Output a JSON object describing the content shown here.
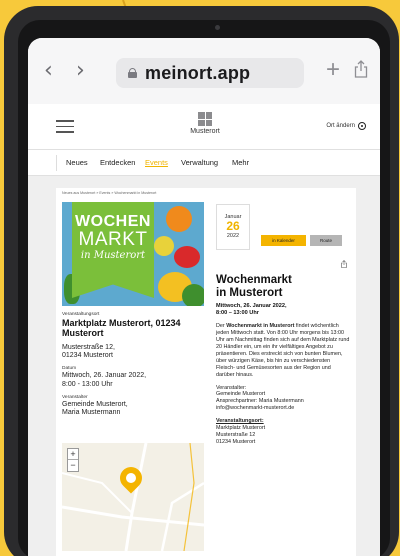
{
  "browser": {
    "url": "meinort.app",
    "back_icon": "chevron-left-icon",
    "forward_icon": "chevron-right-icon"
  },
  "header": {
    "logo_text": "Musterort",
    "location_label": "Ort ändern"
  },
  "menu": {
    "items": [
      "Neues",
      "Entdecken",
      "Events",
      "Verwaltung",
      "Mehr"
    ],
    "active": "Events",
    "active_color": "#f0b400"
  },
  "breadcrumb": "Neues aus Musterort » Events » Wochenmarkt in Musterort",
  "hero": {
    "line1": "WOCHEN",
    "line2": "MARKT",
    "line3": "in Musterort",
    "banner_color": "#7bbf3a"
  },
  "venue": {
    "label": "Veranstaltungsort",
    "name": "Marktplatz Musterort, 01234 Musterort",
    "street": "Musterstraße 12,",
    "city": "01234 Musterort"
  },
  "date_info": {
    "label": "Datum",
    "line1": "Mittwoch, 26. Januar 2022,",
    "line2": "8:00 - 13:00 Uhr"
  },
  "organizer": {
    "label": "Veranstalter",
    "line1": "Gemeinde Musterort,",
    "line2": "Maria Mustermann"
  },
  "map": {
    "zoom_in": "+",
    "zoom_out": "−"
  },
  "date_box": {
    "month": "Januar",
    "day": "26",
    "year": "2022"
  },
  "buttons": {
    "calendar": "in Kalender",
    "route": "Route"
  },
  "event": {
    "title_line1": "Wochenmarkt",
    "title_line2": "in Musterort",
    "date_line1": "Mittwoch, 26. Januar 2022,",
    "date_line2": "8:00 – 13:00 Uhr",
    "desc_bold": "Wochenmarkt in Musterort",
    "desc_prefix": "Der ",
    "desc_rest": " findet wöchentlich jeden Mittwoch statt. Von 8:00 Uhr morgens bis 13:00 Uhr am Nachmittag finden sich auf dem Marktplatz rund 20 Händler ein, um ein ihr vielfältiges Angebot zu präsentieren. Dies erstreckt sich von bunten Blumen, über würzigen Käse, bis hin zu verschiedensten Fleisch- und Gemüsesorten aus der Region und darüber hinaus.",
    "org_title": "Veranstalter:",
    "org_line1": "Gemeinde Musterort",
    "org_line2": "Ansprechpartner: Maria Mustermann",
    "org_line3": "info@wochenmarkt-musterort.de",
    "venue_title": "Veranstaltungsort:",
    "venue_line1": "Marktplatz Musterort",
    "venue_line2": "Musterstraße 12",
    "venue_line3": "01234 Musterort"
  }
}
